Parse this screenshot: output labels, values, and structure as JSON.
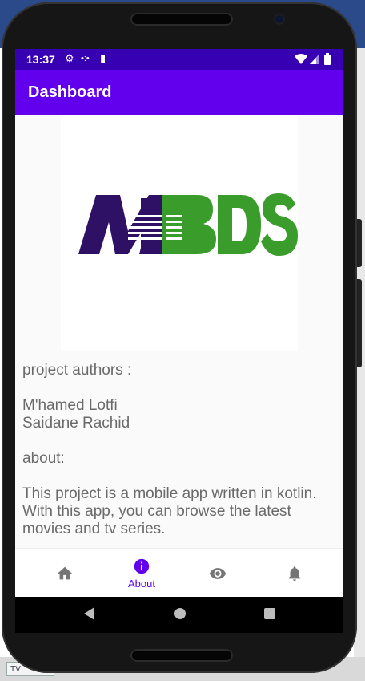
{
  "status_bar": {
    "time": "13:37",
    "icons": [
      "gear-icon",
      "dots-icon",
      "sd-card-icon",
      "wifi-icon",
      "signal-icon",
      "battery-icon"
    ]
  },
  "app_bar": {
    "title": "Dashboard"
  },
  "logo": {
    "text": "MBDS",
    "colors": {
      "dark": "#2e1065",
      "green": "#3a9c2a"
    }
  },
  "about_text": "project authors :\n\nM'hamed Lotfi\nSaidane Rachid\n\nabout:\n\n This project is a mobile app written in kotlin. With this app, you can browse the latest movies and tv series.",
  "bottom_nav": {
    "items": [
      {
        "icon": "home-icon",
        "label": ""
      },
      {
        "icon": "info-icon",
        "label": "About"
      },
      {
        "icon": "eye-icon",
        "label": ""
      },
      {
        "icon": "bell-icon",
        "label": ""
      }
    ],
    "active_color": "#6200ee",
    "inactive_color": "#757575"
  },
  "colors": {
    "primary": "#6200ee",
    "primary_dark": "#3700b3"
  }
}
